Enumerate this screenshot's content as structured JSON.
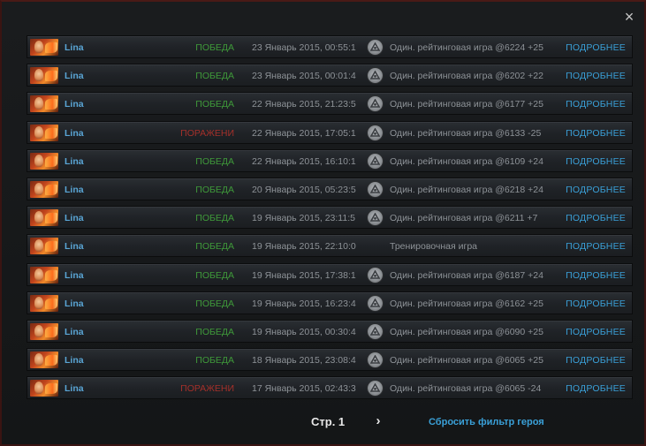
{
  "close_symbol": "×",
  "hero_icon": "lina-portrait-icon",
  "mode_icon": "ranked-medal-icon",
  "matches": [
    {
      "hero": "Lina",
      "result": "ПОБЕДА",
      "outcome": "win",
      "date": "23 Январь 2015, 00:55:1",
      "mode": "Один. рейтинговая игра @6224 +25",
      "ranked": true,
      "details": "ПОДРОБНЕЕ"
    },
    {
      "hero": "Lina",
      "result": "ПОБЕДА",
      "outcome": "win",
      "date": "23 Январь 2015, 00:01:4",
      "mode": "Один. рейтинговая игра @6202 +22",
      "ranked": true,
      "details": "ПОДРОБНЕЕ"
    },
    {
      "hero": "Lina",
      "result": "ПОБЕДА",
      "outcome": "win",
      "date": "22 Январь 2015, 21:23:5",
      "mode": "Один. рейтинговая игра @6177 +25",
      "ranked": true,
      "details": "ПОДРОБНЕЕ"
    },
    {
      "hero": "Lina",
      "result": "ПОРАЖЕНИ",
      "outcome": "loss",
      "date": "22 Январь 2015, 17:05:1",
      "mode": "Один. рейтинговая игра @6133 -25",
      "ranked": true,
      "details": "ПОДРОБНЕЕ"
    },
    {
      "hero": "Lina",
      "result": "ПОБЕДА",
      "outcome": "win",
      "date": "22 Январь 2015, 16:10:1",
      "mode": "Один. рейтинговая игра @6109 +24",
      "ranked": true,
      "details": "ПОДРОБНЕЕ"
    },
    {
      "hero": "Lina",
      "result": "ПОБЕДА",
      "outcome": "win",
      "date": "20 Январь 2015, 05:23:5",
      "mode": "Один. рейтинговая игра @6218 +24",
      "ranked": true,
      "details": "ПОДРОБНЕЕ"
    },
    {
      "hero": "Lina",
      "result": "ПОБЕДА",
      "outcome": "win",
      "date": "19 Январь 2015, 23:11:5",
      "mode": "Один. рейтинговая игра @6211 +7",
      "ranked": true,
      "details": "ПОДРОБНЕЕ"
    },
    {
      "hero": "Lina",
      "result": "ПОБЕДА",
      "outcome": "win",
      "date": "19 Январь 2015, 22:10:0",
      "mode": "Тренировочная игра",
      "ranked": false,
      "details": "ПОДРОБНЕЕ"
    },
    {
      "hero": "Lina",
      "result": "ПОБЕДА",
      "outcome": "win",
      "date": "19 Январь 2015, 17:38:1",
      "mode": "Один. рейтинговая игра @6187 +24",
      "ranked": true,
      "details": "ПОДРОБНЕЕ"
    },
    {
      "hero": "Lina",
      "result": "ПОБЕДА",
      "outcome": "win",
      "date": "19 Январь 2015, 16:23:4",
      "mode": "Один. рейтинговая игра @6162 +25",
      "ranked": true,
      "details": "ПОДРОБНЕЕ"
    },
    {
      "hero": "Lina",
      "result": "ПОБЕДА",
      "outcome": "win",
      "date": "19 Январь 2015, 00:30:4",
      "mode": "Один. рейтинговая игра @6090 +25",
      "ranked": true,
      "details": "ПОДРОБНЕЕ"
    },
    {
      "hero": "Lina",
      "result": "ПОБЕДА",
      "outcome": "win",
      "date": "18 Январь 2015, 23:08:4",
      "mode": "Один. рейтинговая игра @6065 +25",
      "ranked": true,
      "details": "ПОДРОБНЕЕ"
    },
    {
      "hero": "Lina",
      "result": "ПОРАЖЕНИ",
      "outcome": "loss",
      "date": "17 Январь 2015, 02:43:3",
      "mode": "Один. рейтинговая игра @6065 -24",
      "ranked": true,
      "details": "ПОДРОБНЕЕ"
    }
  ],
  "pagination": {
    "page_label": "Стр. 1",
    "next_symbol": "›"
  },
  "reset_filter": "Сбросить фильтр героя",
  "colors": {
    "win": "#3f9a3a",
    "loss": "#a4302a",
    "link": "#3aa0d8",
    "hero": "#5aa6d6"
  }
}
